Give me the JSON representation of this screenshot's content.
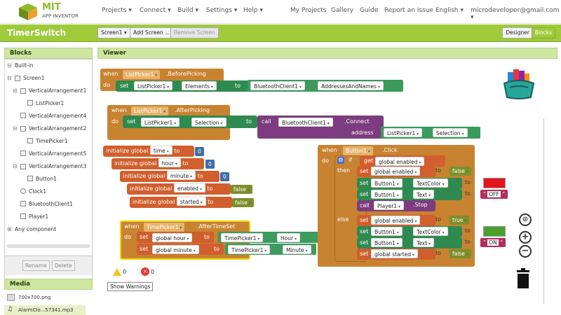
{
  "brand": {
    "mit": "MIT",
    "sub": "APP INVENTOR"
  },
  "menu": {
    "projects": "Projects",
    "connect": "Connect",
    "build": "Build",
    "settings": "Settings",
    "help": "Help",
    "my_projects": "My Projects",
    "gallery": "Gallery",
    "guide": "Guide",
    "report": "Report an Issue",
    "language": "English",
    "account": "microdeveloper@gmail.com"
  },
  "project": {
    "name": "TimerSwitch",
    "screen": "Screen1",
    "add_screen": "Add Screen ...",
    "remove_screen": "Remove Screen",
    "designer": "Designer",
    "blocks": "Blocks"
  },
  "blocks_panel": {
    "title": "Blocks",
    "built_in": "Built-in",
    "screen": "Screen1",
    "any": "Any component",
    "items": [
      "VerticalArrangement1",
      "ListPicker1",
      "VerticalArrangement4",
      "VerticalArrangement2",
      "TimePicker1",
      "VerticalArrangement5",
      "VerticalArrangement3",
      "Button1",
      "Clock1",
      "BluetoothClient1",
      "Player1"
    ],
    "rename": "Rename",
    "delete": "Delete"
  },
  "media": {
    "title": "Media",
    "files": [
      "700x700.png",
      "AlarmClo...57341.mp3"
    ]
  },
  "viewer": {
    "title": "Viewer"
  },
  "blocks": {
    "when": "when",
    "do": "do",
    "set": "set",
    "to": "to",
    "call": "call",
    "address": "address",
    "initialize": "initialize",
    "global": "global",
    "if": "if",
    "then": "then",
    "else": "else",
    "get": "get",
    "lp1": "ListPicker1",
    "before": ".BeforePicking",
    "after": ".AfterPicking",
    "elements": "Elements",
    "bt": "BluetoothClient1",
    "addr_names": "AddressesAndNames",
    "selection": "Selection",
    "connect": ".Connect",
    "v_time": "time",
    "v_hour": "hour",
    "v_minute": "minute",
    "v_enabled": "enabled",
    "v_started": "started",
    "zero": "0",
    "false": "false",
    "true": "true",
    "btn1": "Button1",
    "click": ".Click",
    "tp1": "TimePicker1",
    "aftertime": ".AfterTimeSet",
    "hour_prop": "Hour",
    "minute_prop": "Minute",
    "textcolor": "TextColor",
    "text": "Text",
    "off": "OFF",
    "on": "ON",
    "player": "Player1",
    "stop": ".Stop",
    "warn_count": "0",
    "err_count": "0",
    "show_warnings": "Show Warnings"
  },
  "colors": {
    "event": "#c88330",
    "set": "#2f8a4f",
    "call": "#7c3c7f",
    "var": "#d05f2d",
    "logic": "#7c8f2a",
    "ctrl": "#c88330",
    "math": "#3f6ea8",
    "text": "#b32d5e",
    "red": "#e3151b",
    "green": "#4aa02c",
    "accent": "#9fcb3a"
  }
}
